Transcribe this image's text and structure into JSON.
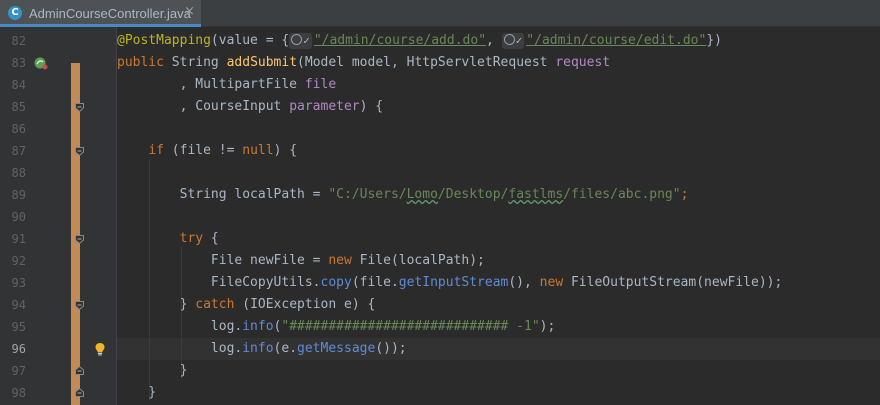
{
  "tab": {
    "icon_letter": "C",
    "label": "AdminCourseController.java",
    "close": "×"
  },
  "lines": [
    {
      "num": "82",
      "s": [
        "@PostMapping",
        "(value = {",
        "\"/admin/course/add.do\"",
        ", ",
        "\"/admin/course/edit.do\"",
        "})"
      ]
    },
    {
      "num": "83",
      "s": [
        "public ",
        "String ",
        "addSubmit",
        "(Model model, HttpServletRequest ",
        "request"
      ]
    },
    {
      "num": "84",
      "s": [
        "        , MultipartFile ",
        "file"
      ]
    },
    {
      "num": "85",
      "s": [
        "        , CourseInput ",
        "parameter",
        ") {"
      ]
    },
    {
      "num": "86",
      "s": []
    },
    {
      "num": "87",
      "s": [
        "    ",
        "if ",
        "(file != ",
        "null",
        ") {"
      ]
    },
    {
      "num": "88",
      "s": []
    },
    {
      "num": "89",
      "s": [
        "        String localPath = ",
        "\"C:/Users/",
        "Lomo",
        "/Desktop/",
        "fastlms",
        "/files/abc.png\"",
        ";"
      ]
    },
    {
      "num": "90",
      "s": []
    },
    {
      "num": "91",
      "s": [
        "        ",
        "try",
        " {"
      ]
    },
    {
      "num": "92",
      "s": [
        "            File newFile = ",
        "new ",
        "File(localPath);"
      ]
    },
    {
      "num": "93",
      "s": [
        "            FileCopyUtils.",
        "copy",
        "(file.",
        "getInputStream",
        "(), ",
        "new ",
        "FileOutputStream(newFile));"
      ]
    },
    {
      "num": "94",
      "s": [
        "        } ",
        "catch ",
        "(IOException e) {"
      ]
    },
    {
      "num": "95",
      "s": [
        "            log.",
        "info",
        "(",
        "\"############################ -1\"",
        ");"
      ]
    },
    {
      "num": "96",
      "s": [
        "            log.",
        "info",
        "(e.",
        "getMessage",
        "());"
      ]
    },
    {
      "num": "97",
      "s": [
        "        }"
      ]
    },
    {
      "num": "98",
      "s": [
        "    }"
      ]
    }
  ],
  "hints": {
    "hint_glyph": "✓"
  },
  "colors": {
    "annotation": "#bbb529",
    "keyword": "#cc7832",
    "string": "#6a8759",
    "method": "#ffc66d",
    "call": "#5f8bd4",
    "default": "#a9b7c6",
    "change_marker": "#c38a56"
  },
  "icons": [
    "java-class-icon",
    "bean-gutter-icon",
    "fold-marker-icon",
    "intention-bulb-icon"
  ]
}
